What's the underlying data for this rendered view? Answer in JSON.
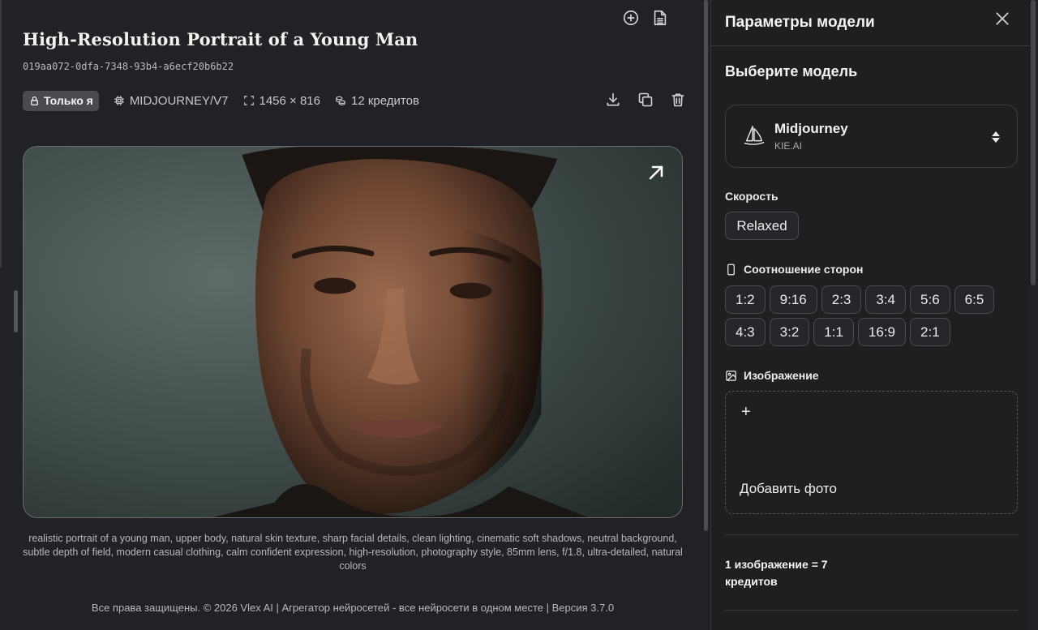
{
  "main": {
    "title": "High-Resolution Portrait of a Young Man",
    "uuid": "019aa072-0dfa-7348-93b4-a6ecf20b6b22",
    "visibility_badge": "Только я",
    "model": "MIDJOURNEY/V7",
    "dimensions": "1456 × 816",
    "credits": "12 кредитов",
    "prompt": "realistic portrait of a young man, upper body, natural skin texture, sharp facial details, clean lighting, cinematic soft shadows, neutral background, subtle depth of field, modern casual clothing, calm confident expression, high-resolution, photography style, 85mm lens, f/1.8, ultra-detailed, natural colors",
    "footer": "Все права защищены. © 2026 Vlex AI | Агрегатор нейросетей - все нейросети в одном месте | Версия 3.7.0",
    "icons": [
      "add-circle-icon",
      "document-icon",
      "lock-icon",
      "chip-icon",
      "expand-corners-icon",
      "coins-icon",
      "download-icon",
      "copy-icon",
      "trash-icon",
      "arrow-up-right-icon"
    ]
  },
  "panel": {
    "title": "Параметры модели",
    "choose_model": "Выберите модель",
    "model_name": "Midjourney",
    "model_provider": "KIE.AI",
    "speed_label": "Скорость",
    "speed_value": "Relaxed",
    "aspect_label": "Соотношение сторон",
    "aspect_ratios": [
      "1:2",
      "9:16",
      "2:3",
      "3:4",
      "5:6",
      "6:5",
      "4:3",
      "3:2",
      "1:1",
      "16:9",
      "2:1"
    ],
    "image_label": "Изображение",
    "upload_plus": "+",
    "upload_label": "Добавить фото",
    "cost": "1 изображение = 7 кредитов"
  },
  "colors": {
    "background": "#212225",
    "panel_background": "#1e1f21",
    "badge": "#4a4b50",
    "text": "#e9e9ea"
  }
}
